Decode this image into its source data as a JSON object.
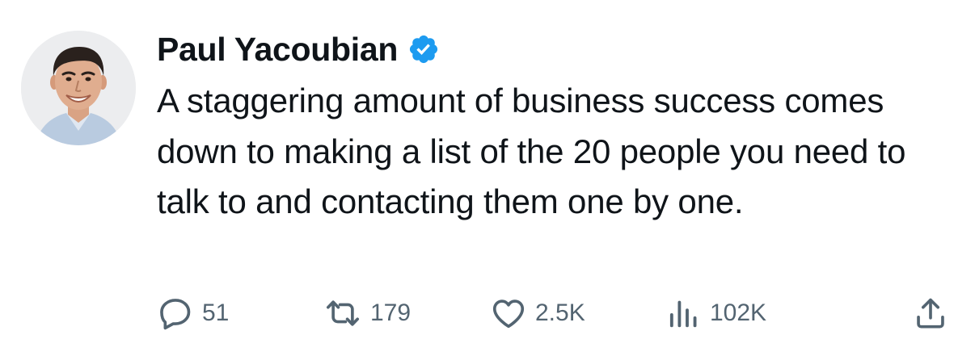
{
  "tweet": {
    "author": {
      "name": "Paul Yacoubian",
      "verified": true,
      "verified_color": "#1d9bf0",
      "avatar_icon": "profile-photo"
    },
    "text": "A staggering amount of business success comes down to making a list of the 20 people you need to talk to and contacting them one by one.",
    "actions": {
      "reply": {
        "icon": "reply-icon",
        "count": "51"
      },
      "retweet": {
        "icon": "retweet-icon",
        "count": "179"
      },
      "like": {
        "icon": "heart-icon",
        "count": "2.5K"
      },
      "views": {
        "icon": "views-chart-icon",
        "count": "102K"
      },
      "share": {
        "icon": "share-icon"
      }
    },
    "colors": {
      "text": "#0f1419",
      "secondary": "#536471",
      "background": "#ffffff"
    }
  }
}
